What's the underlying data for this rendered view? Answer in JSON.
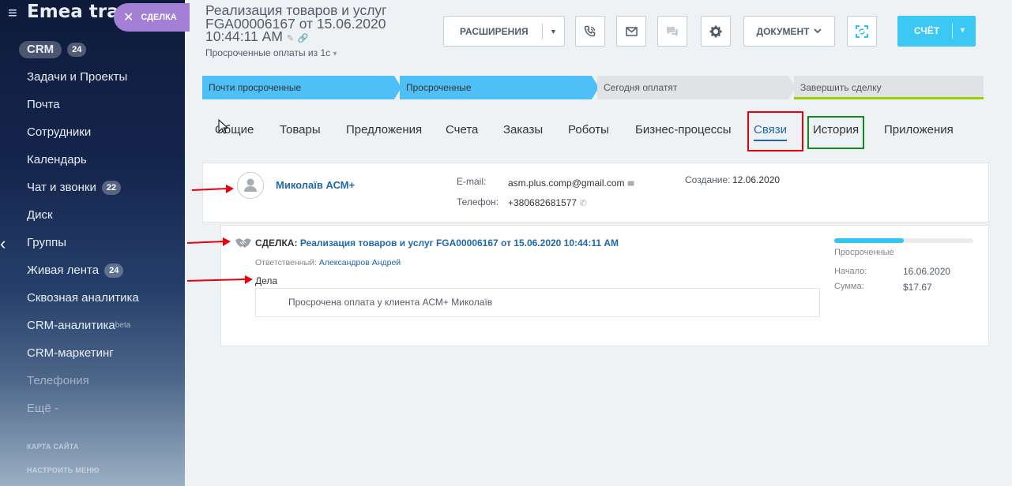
{
  "sidebar": {
    "brand": "Emea trad",
    "deal_pill": "СДЕЛКА",
    "items": [
      {
        "label": "CRM",
        "count": "24"
      },
      {
        "label": "Задачи и Проекты"
      },
      {
        "label": "Почта"
      },
      {
        "label": "Сотрудники"
      },
      {
        "label": "Календарь"
      },
      {
        "label": "Чат и звонки",
        "count": "22"
      },
      {
        "label": "Диск"
      },
      {
        "label": "Группы"
      },
      {
        "label": "Живая лента",
        "count": "24"
      },
      {
        "label": "Сквозная аналитика"
      },
      {
        "label": "CRM-аналитика",
        "sup": "beta"
      },
      {
        "label": "CRM-маркетинг"
      },
      {
        "label": "Телефония"
      },
      {
        "label": "Ещё -"
      }
    ],
    "site_map": "КАРТА САЙТА",
    "configure_menu": "НАСТРОИТЬ МЕНЮ"
  },
  "header": {
    "title": "Реализация товаров и услуг FGA00006167 от 15.06.2020 10:44:11 AM",
    "subtitle": "Просроченные оплаты из 1с",
    "extensions_label": "РАСШИРЕНИЯ",
    "document_label": "ДОКУМЕНТ",
    "account_label": "СЧЁТ"
  },
  "stages": [
    {
      "label": "Почти просроченные",
      "state": "done"
    },
    {
      "label": "Просроченные",
      "state": "done"
    },
    {
      "label": "Сегодня оплатят",
      "state": "todo"
    },
    {
      "label": "Завершить сделку",
      "state": "todo"
    }
  ],
  "tabs": [
    {
      "label": "Общие"
    },
    {
      "label": "Товары"
    },
    {
      "label": "Предложения"
    },
    {
      "label": "Счета"
    },
    {
      "label": "Заказы"
    },
    {
      "label": "Роботы"
    },
    {
      "label": "Бизнес-процессы"
    },
    {
      "label": "Связи",
      "active": true
    },
    {
      "label": "История"
    },
    {
      "label": "Приложения"
    }
  ],
  "contact": {
    "name": "Миколаїв АСМ+",
    "email_label": "E-mail:",
    "email": "asm.plus.comp@gmail.com",
    "phone_label": "Телефон:",
    "phone": "+380682681577",
    "created_label": "Создание:",
    "created": "12.06.2020"
  },
  "deal": {
    "prefix": "СДЕЛКА:",
    "title": "Реализация товаров и услуг FGA00006167 от 15.06.2020 10:44:11 AM",
    "responsible_label": "Ответственный:",
    "responsible": "Александров Андрей",
    "activities_label": "Дела",
    "activity_text": "Просрочена оплата у клиента АСМ+ Миколаїв",
    "stage": "Просроченные",
    "stage_progress": 0.5,
    "start_label": "Начало:",
    "start": "16.06.2020",
    "sum_label": "Сумма:",
    "sum": "$17.67"
  },
  "colors": {
    "accent_blue": "#2067b0",
    "stage_done": "#4ec0f7",
    "account_button": "#3bc8f5",
    "highlight_red": "#e8000b",
    "highlight_green": "#12871c",
    "arrow_red": "#e8000b"
  }
}
